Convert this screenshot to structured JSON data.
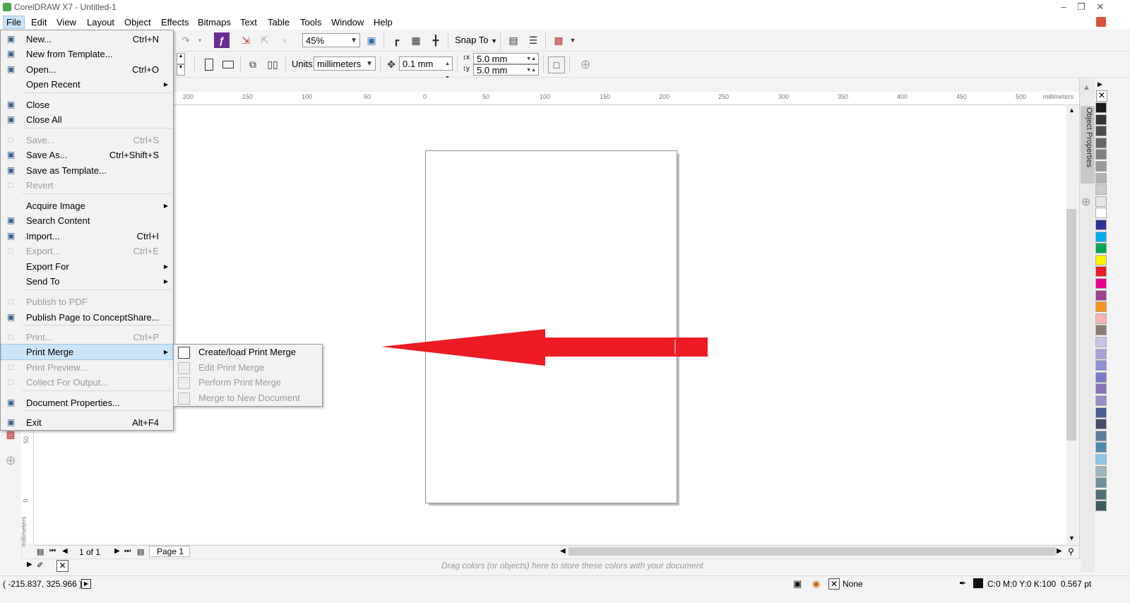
{
  "window": {
    "title": "CorelDRAW X7 - Untitled-1"
  },
  "menubar": [
    "File",
    "Edit",
    "View",
    "Layout",
    "Object",
    "Effects",
    "Bitmaps",
    "Text",
    "Table",
    "Tools",
    "Window",
    "Help"
  ],
  "toolbar": {
    "zoom": "45%",
    "snap_to": "Snap To",
    "units_label": "Units:",
    "units_value": "millimeters",
    "nudge": "0.1 mm",
    "dup_x": "5.0 mm",
    "dup_y": "5.0 mm"
  },
  "ruler": {
    "unit": "millimeters",
    "ticks": [
      "200",
      "150",
      "100",
      "50",
      "0",
      "50",
      "100",
      "150",
      "200",
      "250",
      "300",
      "350",
      "400",
      "450",
      "500"
    ],
    "vticks": [
      "50",
      "0"
    ],
    "vunit": "millimeters"
  },
  "file_menu": [
    {
      "label": "New...",
      "shortcut": "Ctrl+N",
      "disabled": false,
      "icon": "new-document-icon"
    },
    {
      "label": "New from Template...",
      "shortcut": "",
      "disabled": false,
      "icon": "new-from-template-icon"
    },
    {
      "label": "Open...",
      "shortcut": "Ctrl+O",
      "disabled": false,
      "icon": "open-folder-icon"
    },
    {
      "label": "Open Recent",
      "shortcut": "",
      "submenu": true,
      "disabled": false,
      "icon": ""
    },
    {
      "label": "Close",
      "shortcut": "",
      "disabled": false,
      "icon": "close-document-icon"
    },
    {
      "label": "Close All",
      "shortcut": "",
      "disabled": false,
      "icon": "close-all-icon"
    },
    {
      "label": "Save...",
      "shortcut": "Ctrl+S",
      "disabled": true,
      "icon": "save-icon"
    },
    {
      "label": "Save As...",
      "shortcut": "Ctrl+Shift+S",
      "disabled": false,
      "icon": "save-as-icon"
    },
    {
      "label": "Save as Template...",
      "shortcut": "",
      "disabled": false,
      "icon": "save-template-icon"
    },
    {
      "label": "Revert",
      "shortcut": "",
      "disabled": true,
      "icon": "revert-icon"
    },
    {
      "label": "Acquire Image",
      "shortcut": "",
      "submenu": true,
      "disabled": false,
      "icon": ""
    },
    {
      "label": "Search Content",
      "shortcut": "",
      "disabled": false,
      "icon": "search-content-icon"
    },
    {
      "label": "Import...",
      "shortcut": "Ctrl+I",
      "disabled": false,
      "icon": "import-icon"
    },
    {
      "label": "Export...",
      "shortcut": "Ctrl+E",
      "disabled": true,
      "icon": "export-icon"
    },
    {
      "label": "Export For",
      "shortcut": "",
      "submenu": true,
      "disabled": false,
      "icon": ""
    },
    {
      "label": "Send To",
      "shortcut": "",
      "submenu": true,
      "disabled": false,
      "icon": ""
    },
    {
      "label": "Publish to PDF",
      "shortcut": "",
      "disabled": true,
      "icon": "pdf-icon"
    },
    {
      "label": "Publish Page to ConceptShare...",
      "shortcut": "",
      "disabled": false,
      "icon": "conceptshare-icon"
    },
    {
      "label": "Print...",
      "shortcut": "Ctrl+P",
      "disabled": true,
      "icon": "print-icon"
    },
    {
      "label": "Print Merge",
      "shortcut": "",
      "submenu": true,
      "disabled": false,
      "highlighted": true,
      "icon": ""
    },
    {
      "label": "Print Preview...",
      "shortcut": "",
      "disabled": true,
      "icon": "print-preview-icon"
    },
    {
      "label": "Collect For Output...",
      "shortcut": "",
      "disabled": true,
      "icon": "collect-output-icon"
    },
    {
      "label": "Document Properties...",
      "shortcut": "",
      "disabled": false,
      "icon": "document-properties-icon"
    },
    {
      "label": "Exit",
      "shortcut": "Alt+F4",
      "disabled": false,
      "icon": "exit-icon"
    }
  ],
  "print_merge_submenu": [
    {
      "label": "Create/load Print Merge",
      "disabled": false,
      "icon": "create-merge-icon"
    },
    {
      "label": "Edit Print Merge",
      "disabled": true,
      "icon": "edit-merge-icon"
    },
    {
      "label": "Perform Print Merge",
      "disabled": true,
      "icon": "perform-merge-icon"
    },
    {
      "label": "Merge to New Document",
      "disabled": true,
      "icon": "merge-new-doc-icon"
    }
  ],
  "docker": {
    "label": "Object Properties"
  },
  "palette": [
    "#ffffff",
    "#1a1a1a",
    "#333333",
    "#4d4d4d",
    "#666666",
    "#808080",
    "#999999",
    "#b3b3b3",
    "#cccccc",
    "#e6e6e6",
    "#ffffff",
    "#2e3192",
    "#00aeef",
    "#00a651",
    "#fff200",
    "#ed1c24",
    "#ec008c",
    "#a0418e",
    "#f7941d",
    "#f9b2b2",
    "#8c7b70",
    "#c9c4e6",
    "#a7a2d8",
    "#8f8fd6",
    "#7a7ac9",
    "#8b72b8",
    "#9b8dc7",
    "#4b5c8f",
    "#4a4a68",
    "#5d7b9c",
    "#4e8ab0",
    "#8ec8e8",
    "#9fb6c0",
    "#6f8f99",
    "#4f6f78",
    "#3f5a60"
  ],
  "page_nav": {
    "counter": "1 of 1",
    "tab": "Page 1"
  },
  "colorbar_hint": "Drag colors (or objects) here to store these colors with your document",
  "status": {
    "coords": "( -215.837, 325.966 )",
    "fill": "None",
    "outline": "C:0 M:0 Y:0 K:100  0.567 pt"
  },
  "accent": {
    "arrow": "#ed1c24",
    "menu_highlight": "#cce4f7"
  }
}
